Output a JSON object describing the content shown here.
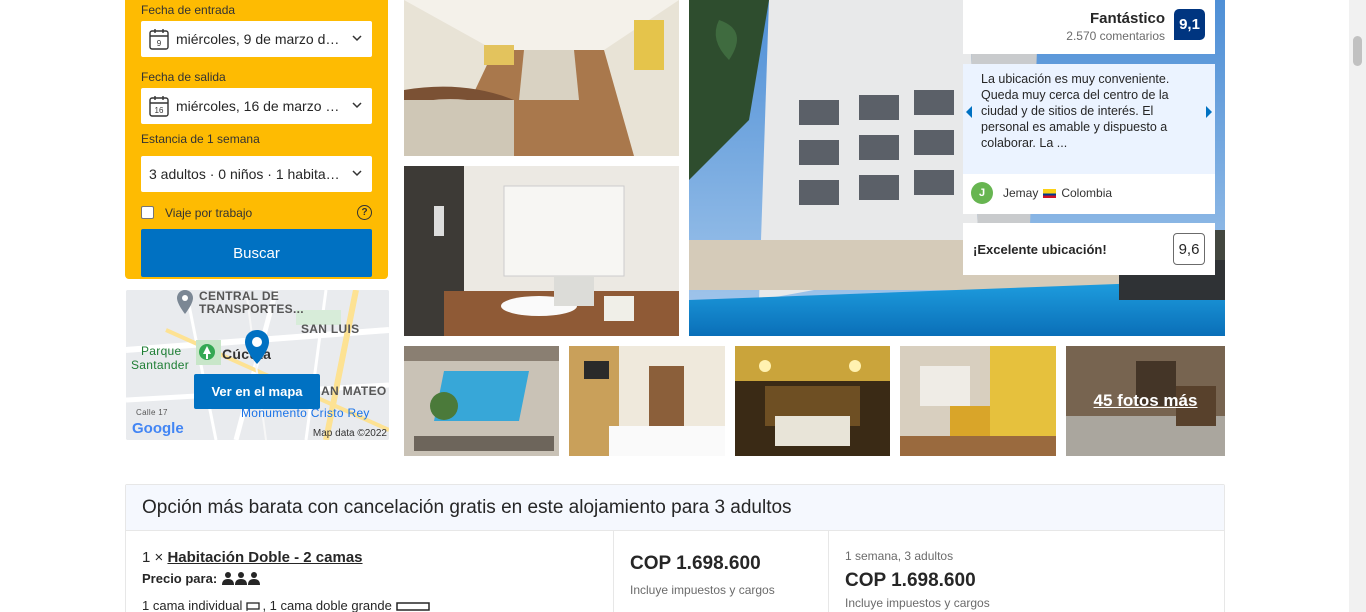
{
  "search": {
    "checkin_label": "Fecha de entrada",
    "checkin_value": "miércoles, 9 de marzo de ...",
    "checkin_day": "9",
    "checkout_label": "Fecha de salida",
    "checkout_value": "miércoles, 16 de marzo de...",
    "checkout_day": "16",
    "stay_label": "Estancia de 1 semana",
    "guests_value": "3 adultos · 0 niños · 1 habitación",
    "work_trip_label": "Viaje por trabajo",
    "help_glyph": "?",
    "search_button": "Buscar"
  },
  "map": {
    "label_central": "CENTRAL DE",
    "label_transportes": "TRANSPORTES...",
    "label_san_luis": "SAN LUIS",
    "label_parque": "Parque",
    "label_santander": "Santander",
    "label_cucuta": "Cúcuta",
    "label_san_mateo": "AN MATEO",
    "label_monumento": "Monumento Cristo Rey",
    "label_calle": "Calle 17",
    "button": "Ver en el mapa",
    "google_logo": "Google",
    "credit": "Map data ©2022"
  },
  "gallery": {
    "more_photos": "45 fotos más"
  },
  "rating": {
    "word": "Fantástico",
    "count": "2.570 comentarios",
    "score": "9,1"
  },
  "review": {
    "text": "La ubicación es muy conveniente. Queda muy cerca del centro de la ciudad y de sitios de interés. El personal es amable y dispuesto a colaborar. La ...",
    "avatar_letter": "J",
    "author": "Jemay",
    "country": "Colombia"
  },
  "location": {
    "label": "¡Excelente ubicación!",
    "score": "9,6"
  },
  "room_offer": {
    "header": "Opción más barata con cancelación gratis en este alojamiento para 3 adultos",
    "quantity": "1 ×",
    "room_name": "Habitación Doble - 2 camas",
    "price_for_label": "Precio para:",
    "beds": "1 cama individual",
    "beds_sep": ", 1 cama doble grande",
    "price": "COP 1.698.600",
    "price_note": "Incluye impuestos y cargos",
    "stay_summary": "1 semana, 3 adultos",
    "price_total": "COP 1.698.600",
    "price_total_note": "Incluye impuestos y cargos"
  },
  "colors": {
    "brand_yellow": "#febb02",
    "brand_blue": "#0071c2",
    "score_navy": "#003580"
  }
}
